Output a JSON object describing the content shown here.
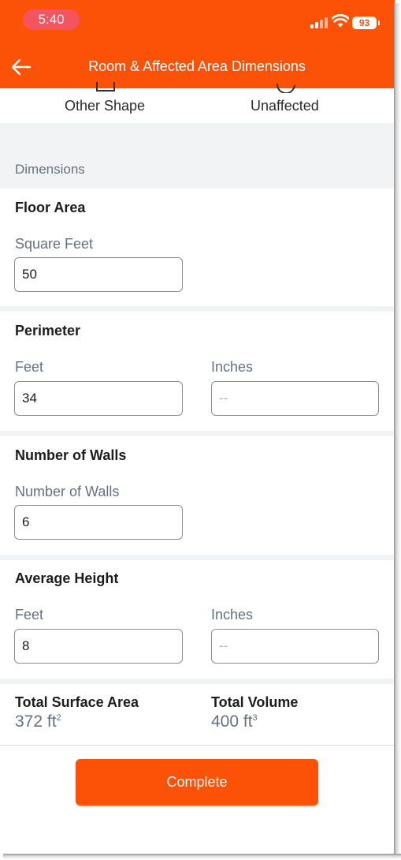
{
  "status_bar": {
    "time": "5:40",
    "battery": "93"
  },
  "header": {
    "title": "Room & Affected Area Dimensions"
  },
  "shape_options": {
    "other_shape": "Other Shape",
    "unaffected": "Unaffected"
  },
  "dimensions": {
    "caption": "Dimensions",
    "floor_area": {
      "title": "Floor Area",
      "label": "Square Feet",
      "value": "50"
    },
    "perimeter": {
      "title": "Perimeter",
      "feet_label": "Feet",
      "feet_value": "34",
      "inches_label": "Inches",
      "inches_placeholder": "--"
    },
    "walls": {
      "title": "Number of Walls",
      "label": "Number of Walls",
      "value": "6"
    },
    "height": {
      "title": "Average Height",
      "feet_label": "Feet",
      "feet_value": "8",
      "inches_label": "Inches",
      "inches_placeholder": "--"
    }
  },
  "totals": {
    "surface_label": "Total Surface Area",
    "surface_value": "372 ft",
    "surface_unit_sup": "2",
    "volume_label": "Total Volume",
    "volume_value": "400 ft",
    "volume_unit_sup": "3"
  },
  "footer": {
    "complete_label": "Complete"
  },
  "colors": {
    "accent": "#fb5207",
    "muted_text": "#66707f",
    "section_bg": "#f2f3f5",
    "time_pill": "#f3545f"
  }
}
